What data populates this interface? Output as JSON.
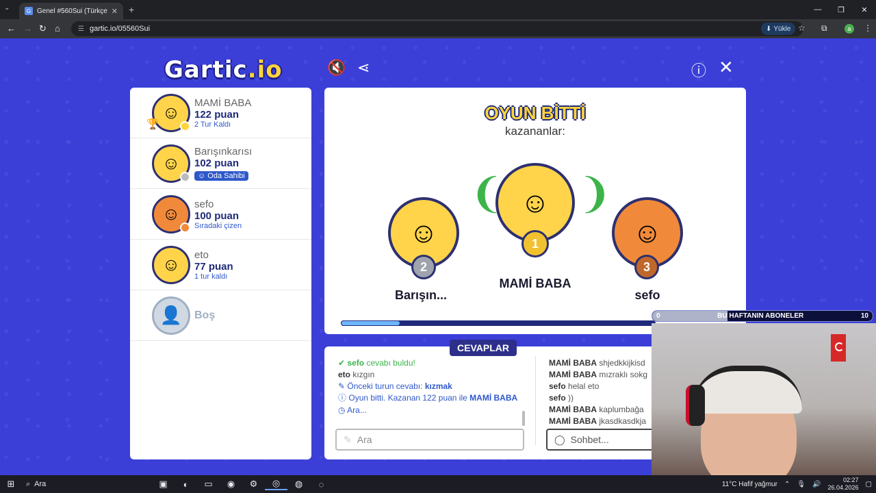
{
  "browser": {
    "tab_title": "Genel #560Sui (Türkçe) - Gartic.io",
    "url": "gartic.io/05560Sui",
    "install_label": "Yükle",
    "profile_letter": "a"
  },
  "header": {
    "logo_main": "Gartic",
    "logo_suffix": ".io"
  },
  "players": [
    {
      "name": "MAMİ BABA",
      "score": "122 puan",
      "sub": "2 Tur Kaldı",
      "dot": "#ffd43b"
    },
    {
      "name": "Barışınkarısı",
      "score": "102 puan",
      "owner_badge": "Oda Sahibi",
      "dot": "#bbbbbb"
    },
    {
      "name": "sefo",
      "score": "100 puan",
      "sub": "Sıradaki çizen",
      "dot": "#f08a3a"
    },
    {
      "name": "eto",
      "score": "77 puan",
      "sub": "1 tur kaldı",
      "dot": ""
    },
    {
      "name": "Boş"
    }
  ],
  "game_over": {
    "title": "OYUN BİTTİ",
    "subtitle": "kazananlar:",
    "first": {
      "name": "MAMİ BABA",
      "rank": "1"
    },
    "second": {
      "name": "Barışın...",
      "rank": "2"
    },
    "third": {
      "name": "sefo",
      "rank": "3"
    },
    "progress": 0.19
  },
  "answers": {
    "title": "CEVAPLAR",
    "found_user": "sefo",
    "found_text": "cevabı buldu!",
    "line2_user": "eto",
    "line2_text": "kızgın",
    "prev_label": "Önceki turun cevabı:",
    "prev_answer": "kızmak",
    "over_text": "Oyun bitti. Kazanan 122 puan ile",
    "over_winner": "MAMİ BABA",
    "wait_text": "Ara...",
    "input_placeholder": "Ara"
  },
  "chat": {
    "messages": [
      {
        "user": "MAMİ BABA",
        "text": "shjedkkijkisd"
      },
      {
        "user": "MAMİ BABA",
        "text": "mızraklı sokg"
      },
      {
        "user": "sefo",
        "text": "helal eto"
      },
      {
        "user": "sefo",
        "text": "))"
      },
      {
        "user": "MAMİ BABA",
        "text": "kaplumbağa"
      },
      {
        "user": "MAMİ BABA",
        "text": "jkasdkasdkja"
      }
    ],
    "input_placeholder": "Sohbet..."
  },
  "overlay": {
    "subs_label": "BU HAFTANIN ABONELER",
    "subs_min": "0",
    "subs_max": "10"
  },
  "taskbar": {
    "search_label": "Ara",
    "weather": "11°C  Hafif yağmur",
    "time": "02:27",
    "date": "26.04.2026"
  }
}
